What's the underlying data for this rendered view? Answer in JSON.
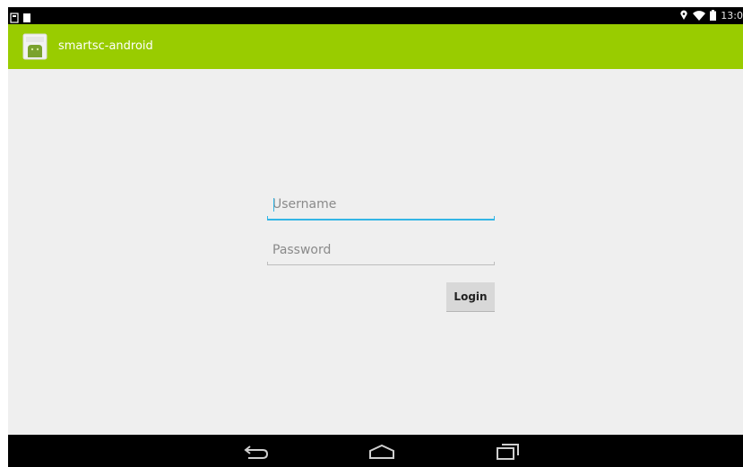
{
  "status_bar": {
    "time": "13:0",
    "left_icons": [
      "sd-card-icon",
      "notification-icon"
    ],
    "right_icons": [
      "location-icon",
      "wifi-icon",
      "battery-icon"
    ]
  },
  "action_bar": {
    "title": "smartsc-android",
    "icon": "app-launcher-icon",
    "color": "#99cc00"
  },
  "login_form": {
    "username": {
      "value": "",
      "placeholder": "Username",
      "focused": true
    },
    "password": {
      "value": "",
      "placeholder": "Password",
      "focused": false
    },
    "login_label": "Login"
  },
  "nav_bar": {
    "buttons": [
      "back-icon",
      "home-icon",
      "recent-apps-icon"
    ]
  },
  "colors": {
    "accent": "#33b5e5",
    "background": "#efefef"
  }
}
